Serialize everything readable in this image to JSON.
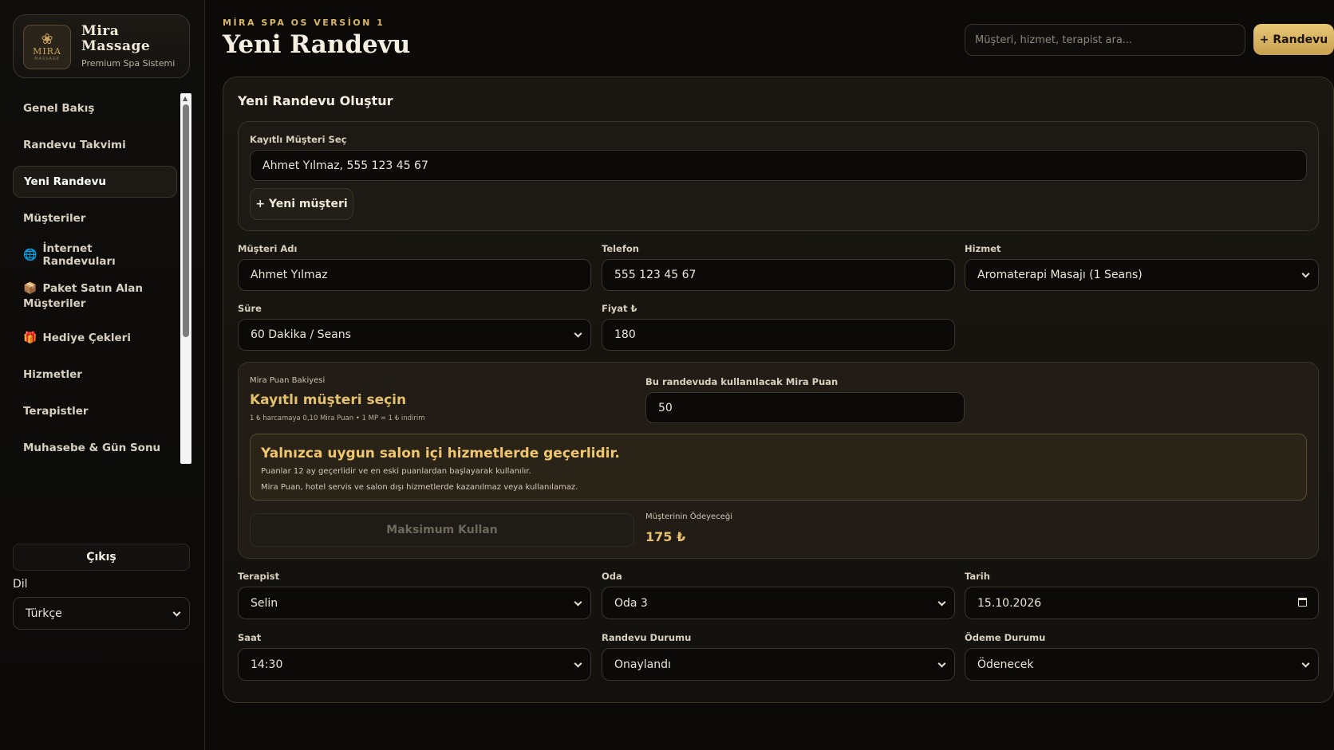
{
  "brand": {
    "logo_text": "MIRA",
    "logo_sub": "MASSAGE",
    "name": "Mira Massage",
    "subtitle": "Premium Spa Sistemi"
  },
  "nav": {
    "items": [
      {
        "label": "Genel Bakış",
        "icon": ""
      },
      {
        "label": "Randevu Takvimi",
        "icon": ""
      },
      {
        "label": "Yeni Randevu",
        "icon": "",
        "active": true
      },
      {
        "label": "Müşteriler",
        "icon": ""
      },
      {
        "label": "İnternet Randevuları",
        "icon": "🌐"
      },
      {
        "label": "Paket Satın Alan Müşteriler",
        "icon": "📦"
      },
      {
        "label": "Hediye Çekleri",
        "icon": "🎁"
      },
      {
        "label": "Hizmetler",
        "icon": ""
      },
      {
        "label": "Terapistler",
        "icon": ""
      },
      {
        "label": "Muhasebe & Gün Sonu",
        "icon": ""
      }
    ]
  },
  "sidebar": {
    "logout_label": "Çıkış",
    "language_label": "Dil",
    "language_value": "Türkçe"
  },
  "header": {
    "eyebrow": "MİRA SPA OS VERSİON 1",
    "title": "Yeni Randevu",
    "search_placeholder": "Müşteri, hizmet, terapist ara...",
    "new_button": "+ Randevu"
  },
  "form": {
    "title": "Yeni Randevu Oluştur",
    "registered_customer_label": "Kayıtlı Müşteri Seç",
    "registered_customer_value": "Ahmet Yılmaz, 555 123 45 67",
    "new_customer_button": "+ Yeni müşteri",
    "customer_name_label": "Müşteri Adı",
    "customer_name_value": "Ahmet Yılmaz",
    "phone_label": "Telefon",
    "phone_value": "555 123 45 67",
    "service_label": "Hizmet",
    "service_value": "Aromaterapi Masajı (1 Seans)",
    "duration_label": "Süre",
    "duration_value": "60 Dakika / Seans",
    "price_label": "Fiyat ₺",
    "price_value": "180",
    "points": {
      "balance_label": "Mira Puan Bakiyesi",
      "balance_value": "Kayıtlı müşteri seçin",
      "rate_note": "1 ₺ harcamaya 0,10 Mira Puan • 1 MP = 1 ₺ indirim",
      "use_label": "Bu randevuda kullanılacak Mira Puan",
      "use_value": "50",
      "notice_title": "Yalnızca uygun salon içi hizmetlerde geçerlidir.",
      "notice_line1": "Puanlar 12 ay geçerlidir ve en eski puanlardan başlayarak kullanılır.",
      "notice_line2": "Mira Puan, hotel servis ve salon dışı hizmetlerde kazanılmaz veya kullanılamaz.",
      "max_button": "Maksimum Kullan",
      "pay_label": "Müşterinin Ödeyeceği",
      "pay_value": "175 ₺"
    },
    "therapist_label": "Terapist",
    "therapist_value": "Selin",
    "room_label": "Oda",
    "room_value": "Oda 3",
    "date_label": "Tarih",
    "date_value": "15.10.2026",
    "time_label": "Saat",
    "time_value": "14:30",
    "status_label": "Randevu Durumu",
    "status_value": "Onaylandı",
    "payment_label": "Ödeme Durumu",
    "payment_value": "Ödenecek"
  },
  "colors": {
    "accent_gold": "#e4c06b",
    "background": "#0b0a08",
    "card": "#1a1712"
  }
}
